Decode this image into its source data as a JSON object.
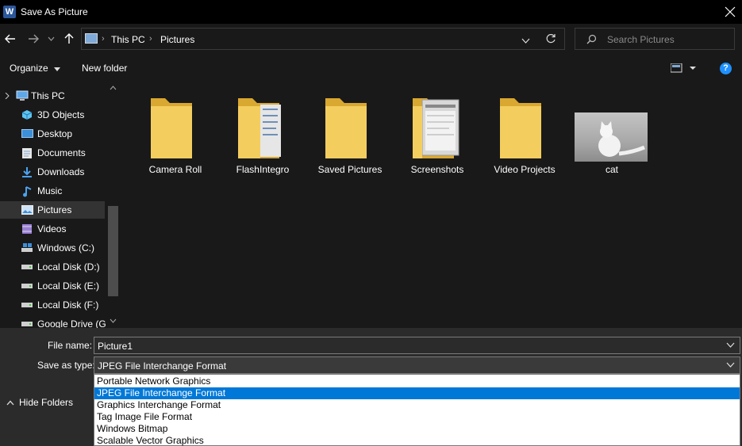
{
  "window": {
    "title": "Save As Picture",
    "app_icon": "word-icon",
    "close_icon": "close-icon"
  },
  "nav": {
    "back_icon": "arrow-left-icon",
    "forward_icon": "arrow-right-icon",
    "recent_icon": "chevron-down-icon",
    "up_icon": "arrow-up-icon",
    "address": [
      "This PC",
      "Pictures"
    ],
    "refresh_icon": "refresh-icon",
    "search_placeholder": "Search Pictures"
  },
  "toolbar": {
    "organize": "Organize",
    "new_folder": "New folder",
    "view_icon": "view-icon",
    "help": "?"
  },
  "sidebar": {
    "items": [
      {
        "label": "This PC",
        "icon": "computer-icon"
      },
      {
        "label": "3D Objects",
        "icon": "cube-icon"
      },
      {
        "label": "Desktop",
        "icon": "desktop-icon"
      },
      {
        "label": "Documents",
        "icon": "documents-icon"
      },
      {
        "label": "Downloads",
        "icon": "download-icon"
      },
      {
        "label": "Music",
        "icon": "music-icon"
      },
      {
        "label": "Pictures",
        "icon": "pictures-icon"
      },
      {
        "label": "Videos",
        "icon": "videos-icon"
      },
      {
        "label": "Windows (C:)",
        "icon": "drive-icon"
      },
      {
        "label": "Local Disk (D:)",
        "icon": "drive-icon"
      },
      {
        "label": "Local Disk (E:)",
        "icon": "drive-icon"
      },
      {
        "label": "Local Disk (F:)",
        "icon": "drive-icon"
      },
      {
        "label": "Google Drive (G:",
        "icon": "drive-icon"
      }
    ],
    "selected": "Pictures"
  },
  "content": {
    "items": [
      {
        "label": "Camera Roll",
        "icon": "folder-icon"
      },
      {
        "label": "FlashIntegro",
        "icon": "folder-icon"
      },
      {
        "label": "Saved Pictures",
        "icon": "folder-icon"
      },
      {
        "label": "Screenshots",
        "icon": "folder-icon"
      },
      {
        "label": "Video Projects",
        "icon": "folder-icon"
      },
      {
        "label": "cat",
        "icon": "image-thumbnail"
      }
    ]
  },
  "form": {
    "file_name_label": "File name:",
    "file_name_value": "Picture1",
    "save_type_label": "Save as type:",
    "save_type_value": "JPEG File Interchange Format",
    "options": [
      "Portable Network Graphics",
      "JPEG File Interchange Format",
      "Graphics Interchange Format",
      "Tag Image File Format",
      "Windows Bitmap",
      "Scalable Vector Graphics"
    ],
    "selected_option": "JPEG File Interchange Format"
  },
  "footer": {
    "hide_folders": "Hide Folders"
  },
  "colors": {
    "background": "#191919",
    "titlebar": "#000000",
    "bottom_panel": "#2b2b2b",
    "selection": "#0078d7",
    "folder": "#f0c75e"
  }
}
